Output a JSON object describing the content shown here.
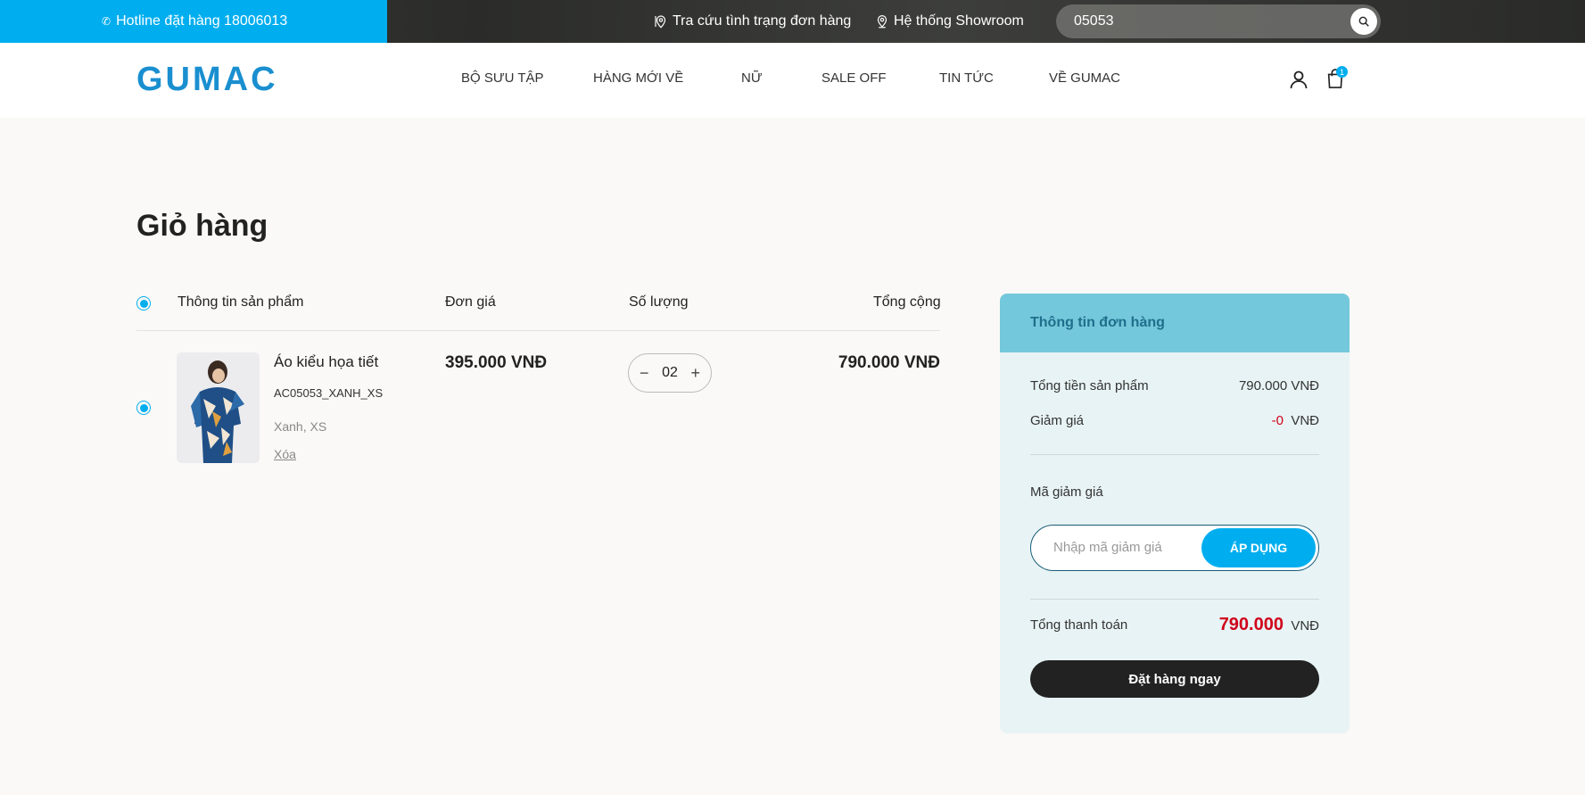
{
  "topbar": {
    "hotline": "Hotline đặt hàng 18006013",
    "order_lookup": "Tra cứu tình trạng đơn hàng",
    "showroom": "Hệ thống Showroom",
    "search_value": "05053"
  },
  "header": {
    "logo": "GUMAC",
    "nav": [
      "BỘ SƯU TẬP",
      "HÀNG MỚI VỀ",
      "NỮ",
      "SALE OFF",
      "TIN TỨC",
      "VỀ GUMAC"
    ],
    "cart_count": "1"
  },
  "cart": {
    "title": "Giỏ hàng",
    "columns": {
      "product": "Thông tin sản phẩm",
      "unit_price": "Đơn giá",
      "quantity": "Số lượng",
      "total": "Tổng cộng"
    },
    "items": [
      {
        "name": "Áo kiểu họa tiết",
        "sku": "AC05053_XANH_XS",
        "variant": "Xanh, XS",
        "remove": "Xóa",
        "price": "395.000 VNĐ",
        "qty": "02",
        "total": "790.000 VNĐ"
      }
    ]
  },
  "summary": {
    "title": "Thông tin đơn hàng",
    "subtotal_label": "Tổng tiền sản phẩm",
    "subtotal_value": "790.000 VNĐ",
    "discount_label": "Giảm giá",
    "discount_value": "-0",
    "discount_unit": "VNĐ",
    "coupon_label": "Mã giảm giá",
    "coupon_placeholder": "Nhập mã giảm giá",
    "apply_label": "ÁP DỤNG",
    "grand_total_label": "Tổng thanh toán",
    "grand_total_value": "790.000",
    "grand_total_unit": "VNĐ",
    "order_button": "Đặt hàng ngay"
  },
  "colors": {
    "accent": "#00aeef",
    "summary_head": "#74c8db",
    "price_red": "#d0021b"
  }
}
